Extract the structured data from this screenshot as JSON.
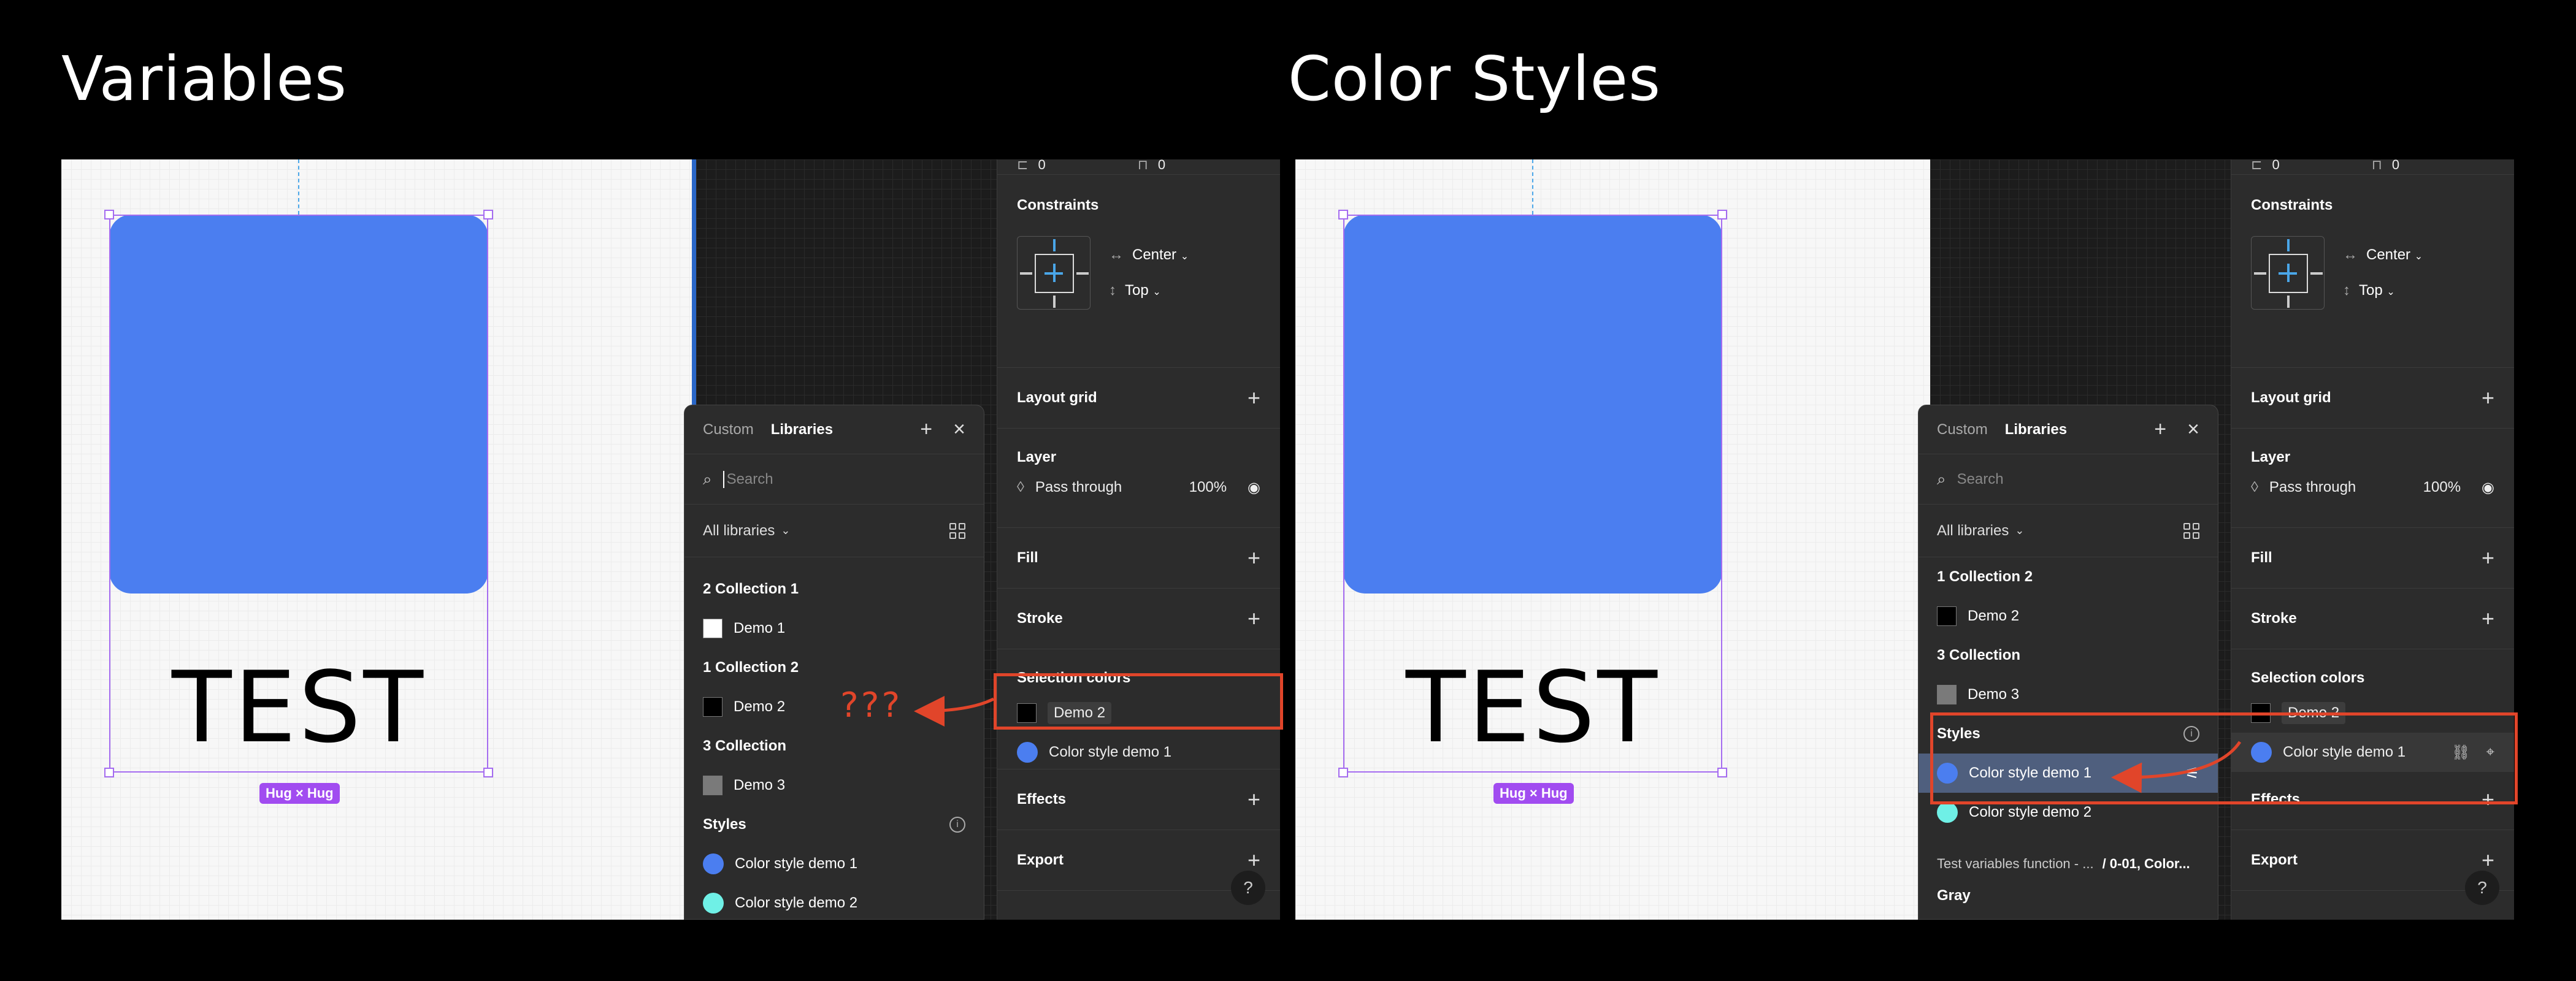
{
  "headings": {
    "left": "Variables",
    "right": "Color Styles"
  },
  "colors": {
    "accent_blue": "#4b7ef0",
    "callout_red": "#e1452a",
    "hug_purple": "#a14cf0"
  },
  "canvas": {
    "text": "TEST",
    "hug_badge": "Hug × Hug"
  },
  "left_panel": {
    "tabs": [
      "Custom",
      "Libraries"
    ],
    "search_placeholder": "Search",
    "library_filter": "All libraries",
    "groups": [
      {
        "title": "2 Collection 1",
        "items": [
          {
            "label": "Demo 1",
            "color": "#ffffff"
          }
        ]
      },
      {
        "title": "1 Collection 2",
        "items": [
          {
            "label": "Demo 2",
            "color": "#000000"
          }
        ]
      },
      {
        "title": "3 Collection",
        "items": [
          {
            "label": "Demo 3",
            "color": "#7a7a7a"
          }
        ]
      }
    ],
    "styles_title": "Styles",
    "styles": [
      {
        "label": "Color style demo 1",
        "color": "#4b7ef0"
      },
      {
        "label": "Color style demo 2",
        "color": "#6ff0e6"
      }
    ]
  },
  "right_panel": {
    "tabs": [
      "Custom",
      "Libraries"
    ],
    "search_placeholder": "Search",
    "library_filter": "All libraries",
    "groups": [
      {
        "title": "1 Collection 2",
        "items": [
          {
            "label": "Demo 2",
            "color": "#000000"
          }
        ]
      },
      {
        "title": "3 Collection",
        "items": [
          {
            "label": "Demo 3",
            "color": "#7a7a7a"
          }
        ]
      }
    ],
    "styles_title": "Styles",
    "styles": [
      {
        "label": "Color style demo 1",
        "color": "#4b7ef0",
        "selected": true
      },
      {
        "label": "Color style demo 2",
        "color": "#6ff0e6"
      }
    ],
    "footer_left": "Test variables function - ...",
    "footer_right": "/ 0-01, Color...",
    "footer_next": "Gray"
  },
  "properties": {
    "top_values": [
      "0",
      "0"
    ],
    "constraints_title": "Constraints",
    "horizontal": "Center",
    "vertical": "Top",
    "layout_grid": "Layout grid",
    "layer_title": "Layer",
    "blend_mode": "Pass through",
    "opacity": "100%",
    "fill": "Fill",
    "stroke": "Stroke",
    "selection_colors": "Selection colors",
    "sel_left": [
      {
        "label": "Demo 2",
        "color": "#000000"
      },
      {
        "label": "Color style demo 1",
        "color": "#4b7ef0"
      }
    ],
    "sel_right": [
      {
        "label": "Demo 2",
        "color": "#000000"
      },
      {
        "label": "Color style demo 1",
        "color": "#4b7ef0"
      }
    ],
    "effects": "Effects",
    "export": "Export",
    "help": "?"
  },
  "annotation": {
    "question": "???"
  }
}
